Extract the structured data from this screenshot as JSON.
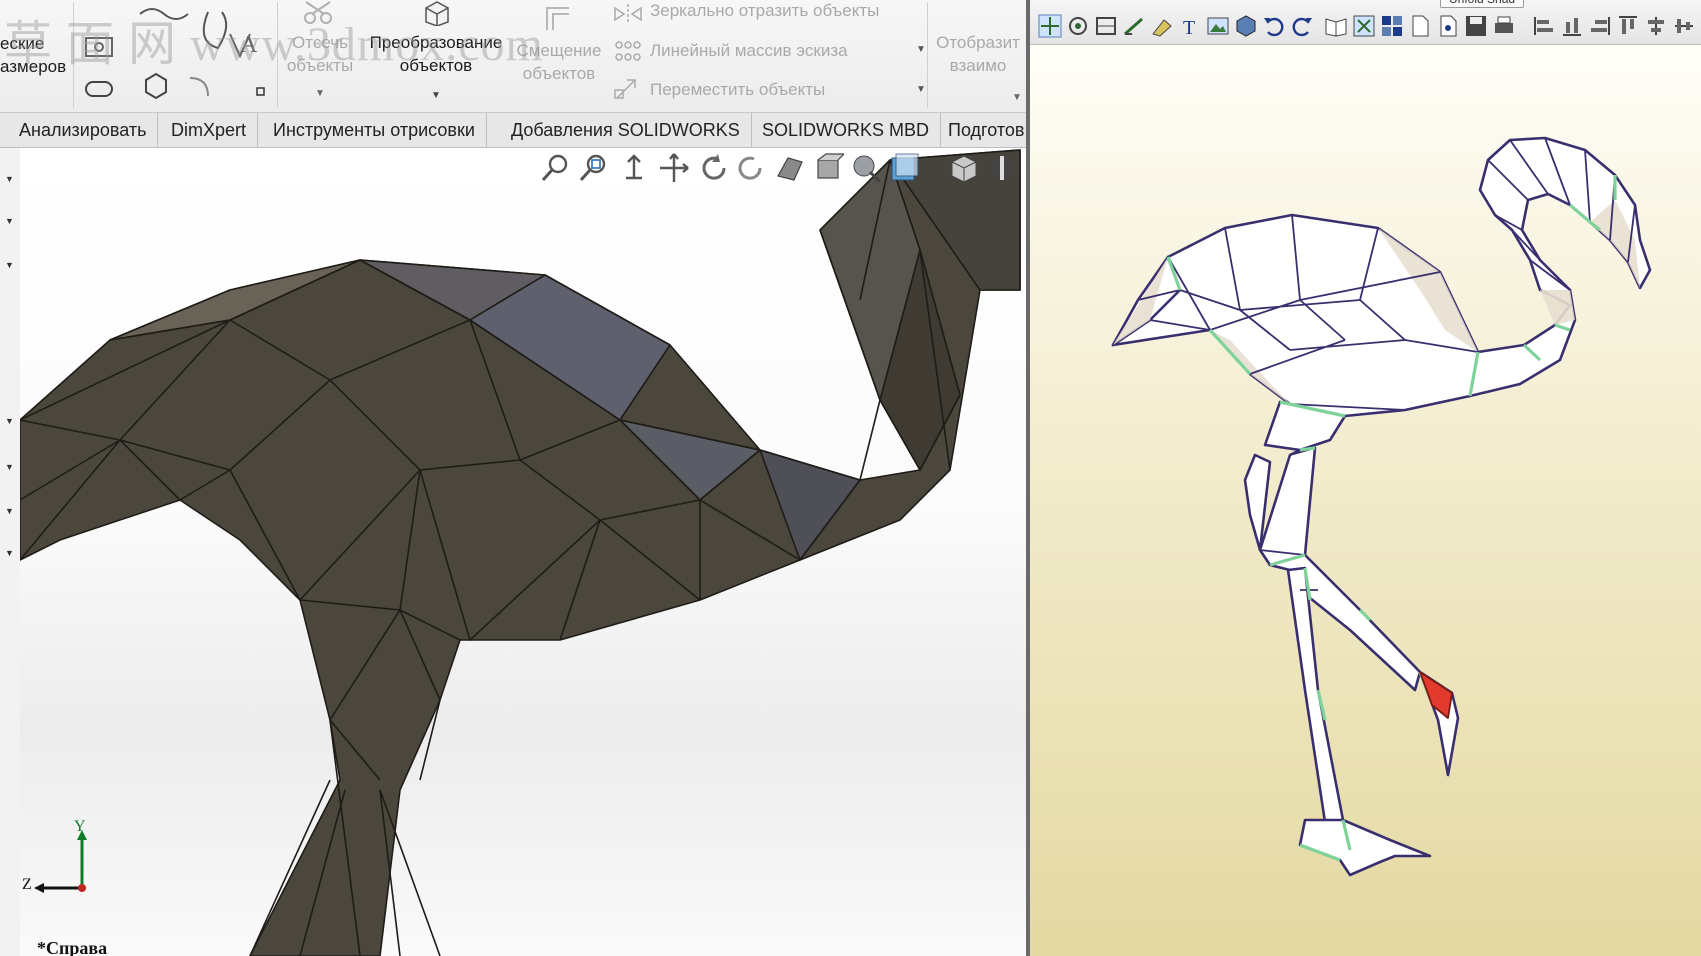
{
  "ribbon": {
    "smart_dim_label": [
      "еские",
      "азмеров"
    ],
    "trim_label": [
      "Отсечь",
      "объекты"
    ],
    "convert_label": [
      "Преобразование",
      "объектов"
    ],
    "offset_label": [
      "Смещение",
      "объектов"
    ],
    "mirror_label": "Зеркально отразить объекты",
    "linear_pattern_label": "Линейный массив эскиза",
    "move_label": "Переместить объекты",
    "display_relations_label": [
      "Отобразит",
      "взаимо"
    ]
  },
  "tabs": [
    "Анализировать",
    "DimXpert",
    "Инструменты отрисовки",
    "Добавления SOLIDWORKS",
    "SOLIDWORKS MBD",
    "Подготов"
  ],
  "viewport": {
    "view_name": "*Справа",
    "triad_y": "Y",
    "triad_z": "Z",
    "watermark": "草 面 网 www.3dmox.com",
    "model_color": "#4b463c"
  },
  "pepakura": {
    "background_top": "#fffef8",
    "background_bottom": "#e4d9a2",
    "edge_color": "#3a2f6e",
    "fold_color": "#7fd39a",
    "beak_color": "#e23b2e",
    "top_button_label": "Unfold Shad"
  }
}
